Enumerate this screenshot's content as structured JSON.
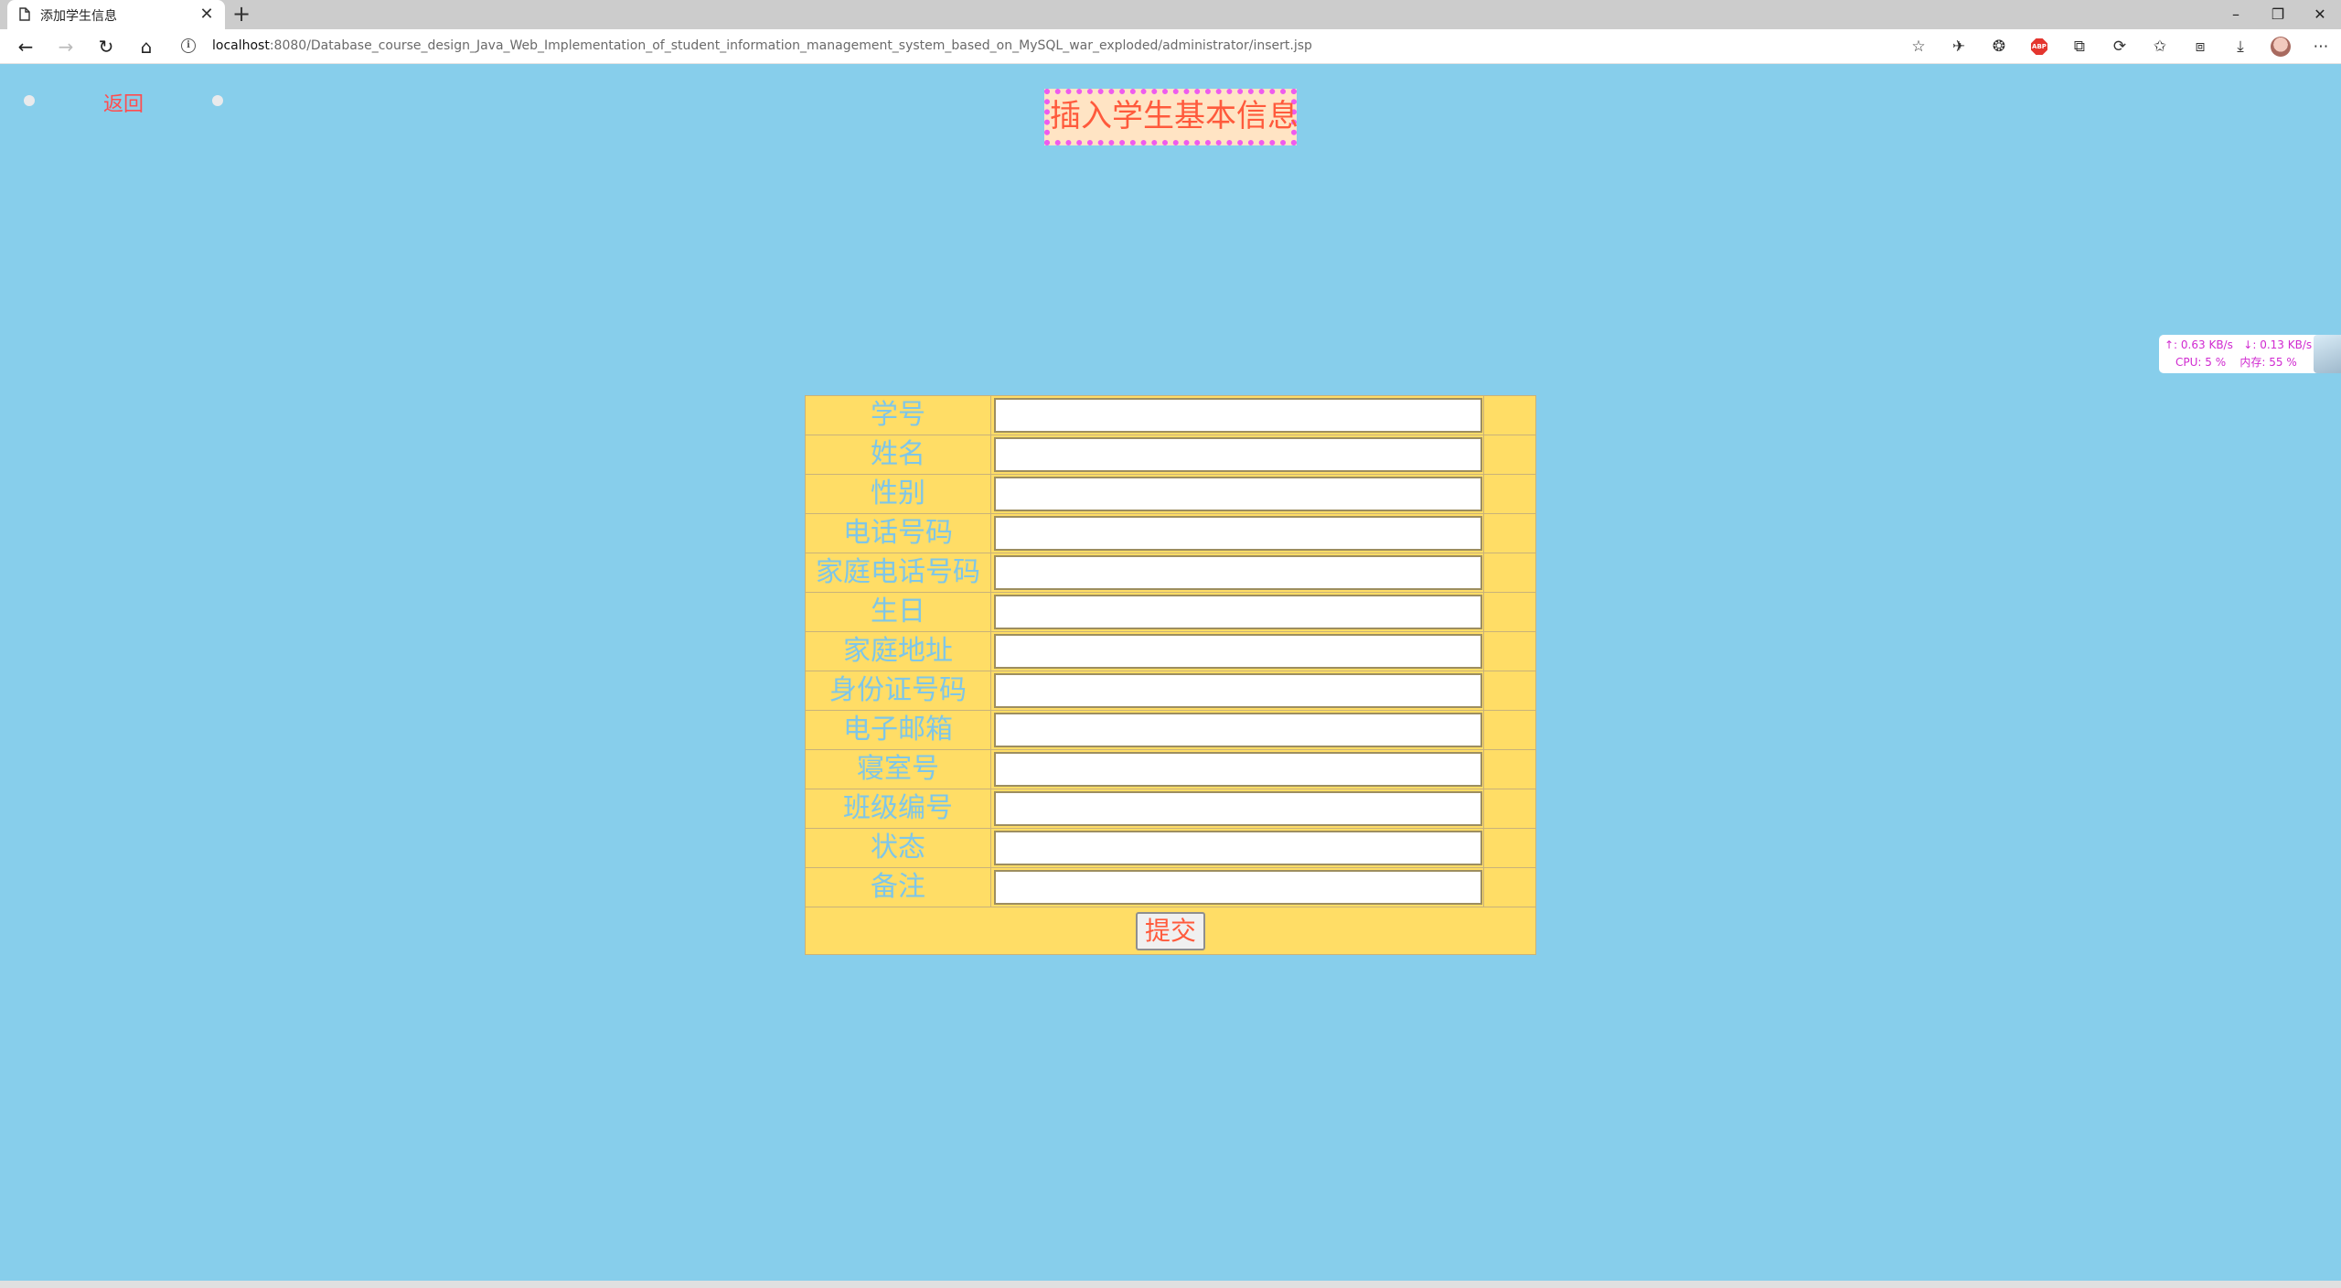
{
  "browser": {
    "tab_title": "添加学生信息",
    "url_host": "localhost",
    "url_rest": ":8080/Database_course_design_Java_Web_Implementation_of_student_information_management_system_based_on_MySQL_war_exploded/administrator/insert.jsp",
    "new_tab_symbol": "+",
    "tab_close_symbol": "✕",
    "window_controls": {
      "minimize": "–",
      "restore": "❐",
      "close": "✕"
    },
    "nav": {
      "back": "←",
      "forward": "→",
      "reload": "↻",
      "home": "⌂"
    },
    "info_symbol": "i",
    "toolbar_icons": {
      "favorite": "☆",
      "ext1": "✈",
      "ext2": "❂",
      "abp": "ABP",
      "collections": "⧉",
      "sync": "⟳",
      "favorites": "✩",
      "split": "⧈",
      "downloads": "⤓",
      "more": "⋯"
    }
  },
  "page": {
    "back_link": "返回",
    "title": "插入学生基本信息",
    "form": {
      "fields": [
        {
          "label": "学号",
          "value": ""
        },
        {
          "label": "姓名",
          "value": ""
        },
        {
          "label": "性别",
          "value": ""
        },
        {
          "label": "电话号码",
          "value": ""
        },
        {
          "label": "家庭电话号码",
          "value": ""
        },
        {
          "label": "生日",
          "value": ""
        },
        {
          "label": "家庭地址",
          "value": ""
        },
        {
          "label": "身份证号码",
          "value": ""
        },
        {
          "label": "电子邮箱",
          "value": ""
        },
        {
          "label": "寝室号",
          "value": ""
        },
        {
          "label": "班级编号",
          "value": ""
        },
        {
          "label": "状态",
          "value": ""
        },
        {
          "label": "备注",
          "value": ""
        }
      ],
      "submit_label": "提交"
    }
  },
  "system_monitor": {
    "upload": "↑: 0.63 KB/s",
    "download": "↓: 0.13 KB/s",
    "cpu": "CPU: 5 %",
    "memory": "内存: 55 %"
  },
  "colors": {
    "page_bg": "#87ceeb",
    "form_bg": "#ffdd66",
    "label_text": "#7ec6e8",
    "accent_red": "#ff5a3c",
    "title_bg": "#ffe4c4",
    "title_border": "#ee5cee"
  }
}
